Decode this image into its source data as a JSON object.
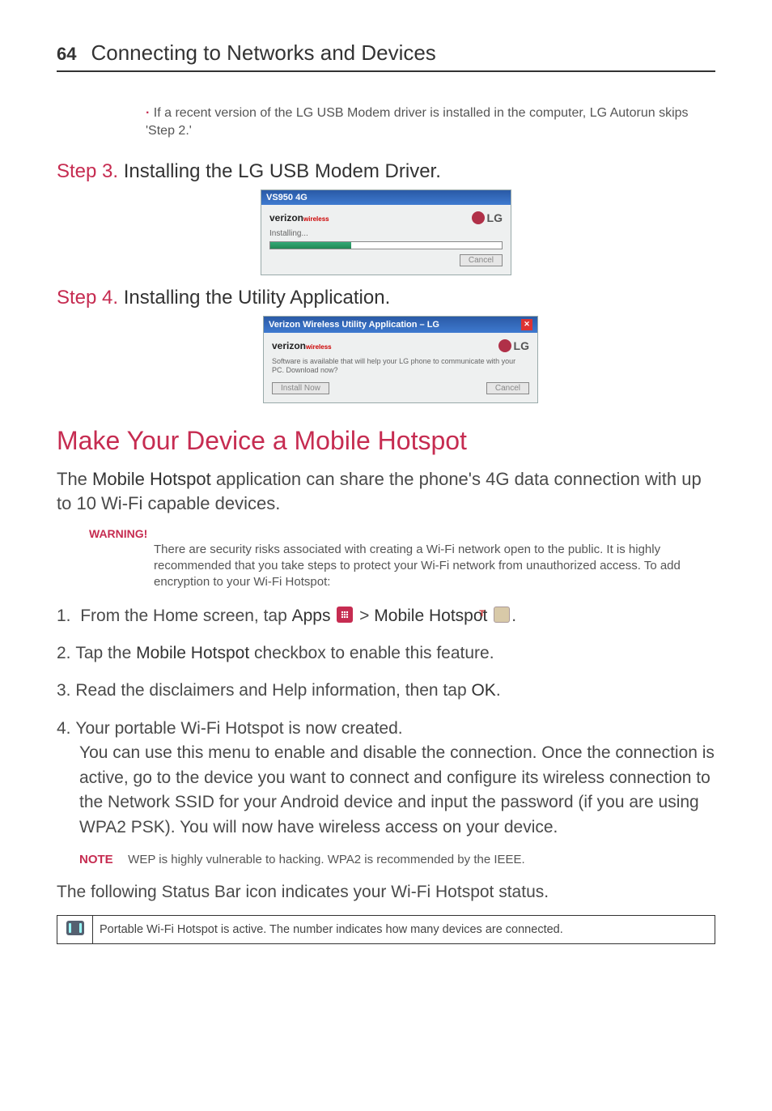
{
  "header": {
    "page_number": "64",
    "title": "Connecting to Networks and Devices"
  },
  "bullet": {
    "marker": "·",
    "text": "If a recent version of the LG USB Modem driver is installed in the computer, LG Autorun skips 'Step 2.'"
  },
  "step3": {
    "prefix": "Step 3.",
    "title": " Installing the LG USB Modem Driver."
  },
  "dialog1": {
    "title": "VS950 4G",
    "brand_verizon": "verizon",
    "brand_verizon_suffix": "wireless",
    "brand_lg": "LG",
    "status": "Installing...",
    "cancel": "Cancel"
  },
  "step4": {
    "prefix": "Step 4.",
    "title": " Installing the Utility Application."
  },
  "dialog2": {
    "title": "Verizon Wireless Utility Application – LG",
    "brand_verizon": "verizon",
    "brand_verizon_suffix": "wireless",
    "brand_lg": "LG",
    "msg": "Software is available that will help your LG phone to communicate with your PC. Download now?",
    "install": "Install Now",
    "cancel": "Cancel"
  },
  "section_title": "Make Your Device a Mobile Hotspot",
  "intro": {
    "pre": "The ",
    "strong": "Mobile Hotspot",
    "post": " application can share the phone's 4G data connection with up to 10 Wi-Fi capable devices."
  },
  "warning": {
    "label": "WARNING!",
    "text": "There are security risks associated with creating a Wi-Fi network open to the public. It is highly recommended that you take steps to protect your Wi-Fi network from unauthorized access. To add encryption to your Wi-Fi Hotspot:"
  },
  "steps": {
    "s1_a": "From the Home screen, tap ",
    "s1_apps": "Apps",
    "s1_gt": " > ",
    "s1_hotspot": "Mobile Hotspot",
    "s1_end": ".",
    "s2_a": "Tap the ",
    "s2_strong": "Mobile Hotspot",
    "s2_b": " checkbox to enable this feature.",
    "s3_a": "Read the disclaimers and Help information, then tap ",
    "s3_strong": "OK",
    "s3_b": ".",
    "s4": "Your portable Wi-Fi Hotspot is now created.\nYou can use this menu to enable and disable the connection. Once the connection is active, go to the device you want to connect and configure its wireless connection to the Network SSID for your Android device and input the password (if you are using WPA2 PSK). You will now have wireless access on your device."
  },
  "note": {
    "label": "NOTE",
    "text": "WEP is highly vulnerable to hacking. WPA2 is recommended by the IEEE."
  },
  "status_line": "The following Status Bar icon indicates your Wi-Fi Hotspot status.",
  "status_table": {
    "desc": "Portable Wi-Fi Hotspot is active. The number indicates how many devices are connected."
  }
}
